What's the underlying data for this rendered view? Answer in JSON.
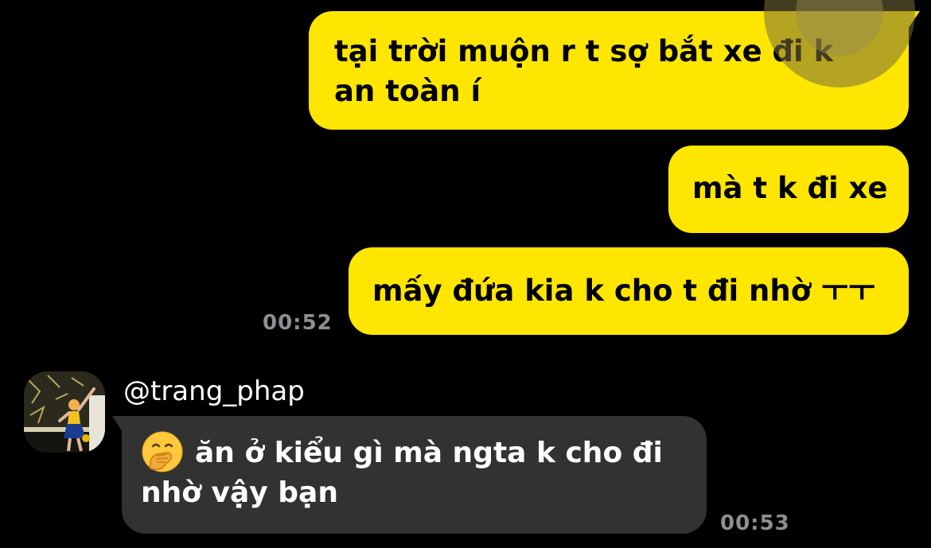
{
  "messages_out": [
    {
      "text": "tại trời muộn r t sợ bắt xe đi k an toàn í"
    },
    {
      "text": "mà t k đi xe"
    },
    {
      "text": "mấy đứa kia k cho t đi nhờ ㅜㅜ"
    }
  ],
  "time_out": "00:52",
  "incoming": {
    "username": "@trang_phap",
    "emoji": "face-with-hand-over-mouth",
    "text": "ăn ở kiểu gì mà ngta k cho đi nhờ vậy bạn",
    "time": "00:53"
  },
  "colors": {
    "background": "#000000",
    "outgoing_bubble": "#FFE600",
    "incoming_bubble": "#323232",
    "timestamp": "#8E8E93"
  }
}
